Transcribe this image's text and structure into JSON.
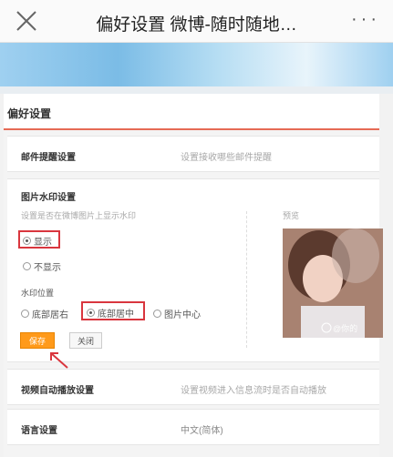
{
  "header": {
    "title": "偏好设置 微博-随时随地…",
    "more": "···"
  },
  "preferences": {
    "section_title": "偏好设置",
    "mail": {
      "label": "邮件提醒设置",
      "desc": "设置接收哪些邮件提醒"
    },
    "watermark": {
      "label": "图片水印设置",
      "desc": "设置是否在微博图片上显示水印",
      "show_label": "显示",
      "hide_label": "不显示",
      "position_label": "水印位置",
      "pos_bottom_right": "底部居右",
      "pos_bottom_center": "底部居中",
      "pos_center": "图片中心",
      "save_label": "保存",
      "close_label": "关闭",
      "preview_label": "预览",
      "preview_watermark": "@你的"
    },
    "video": {
      "label": "视频自动播放设置",
      "desc": "设置视频进入信息流时是否自动播放"
    },
    "language": {
      "label": "语言设置",
      "value": "中文(简体)"
    }
  },
  "watermark_overlay": "搜搜游戏",
  "colors": {
    "accent": "#e66a55",
    "highlight": "#d9363e",
    "save_button": "#ff9a1a"
  }
}
